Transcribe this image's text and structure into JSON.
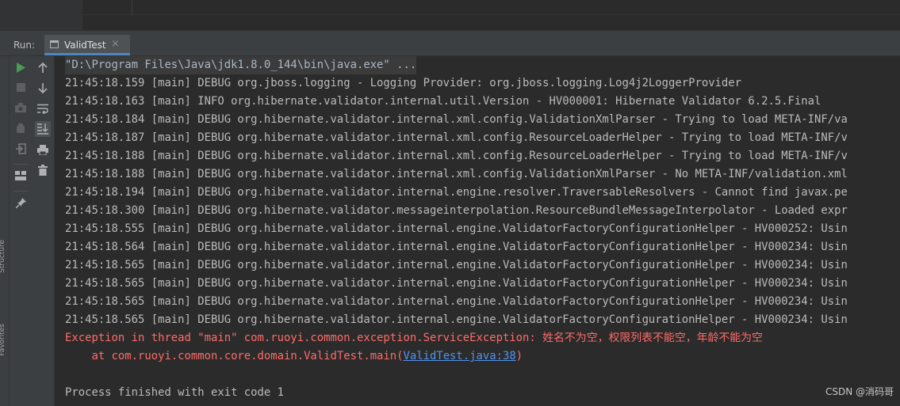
{
  "run_panel": {
    "label": "Run:",
    "tab_label": "ValidTest",
    "tab_close": "×"
  },
  "side_strip": {
    "items": [
      "Structure",
      "Favorites"
    ]
  },
  "toolbar": {
    "left_icons": [
      "run-icon",
      "stop-icon",
      "camera-icon",
      "debug-icon",
      "login-icon",
      "layout-icon",
      "pin-icon"
    ],
    "right_icons": [
      "up-arrow-icon",
      "down-arrow-icon",
      "soft-wrap-icon",
      "scroll-to-end-icon",
      "print-icon",
      "trash-icon"
    ]
  },
  "console": {
    "command_line": "\"D:\\Program Files\\Java\\jdk1.8.0_144\\bin\\java.exe\" ...",
    "log_lines": [
      "21:45:18.159 [main] DEBUG org.jboss.logging - Logging Provider: org.jboss.logging.Log4j2LoggerProvider",
      "21:45:18.163 [main] INFO org.hibernate.validator.internal.util.Version - HV000001: Hibernate Validator 6.2.5.Final",
      "21:45:18.184 [main] DEBUG org.hibernate.validator.internal.xml.config.ValidationXmlParser - Trying to load META-INF/va",
      "21:45:18.187 [main] DEBUG org.hibernate.validator.internal.xml.config.ResourceLoaderHelper - Trying to load META-INF/v",
      "21:45:18.188 [main] DEBUG org.hibernate.validator.internal.xml.config.ResourceLoaderHelper - Trying to load META-INF/v",
      "21:45:18.188 [main] DEBUG org.hibernate.validator.internal.xml.config.ValidationXmlParser - No META-INF/validation.xml",
      "21:45:18.194 [main] DEBUG org.hibernate.validator.internal.engine.resolver.TraversableResolvers - Cannot find javax.pe",
      "21:45:18.300 [main] DEBUG org.hibernate.validator.messageinterpolation.ResourceBundleMessageInterpolator - Loaded expr",
      "21:45:18.555 [main] DEBUG org.hibernate.validator.internal.engine.ValidatorFactoryConfigurationHelper - HV000252: Usin",
      "21:45:18.564 [main] DEBUG org.hibernate.validator.internal.engine.ValidatorFactoryConfigurationHelper - HV000234: Usin",
      "21:45:18.565 [main] DEBUG org.hibernate.validator.internal.engine.ValidatorFactoryConfigurationHelper - HV000234: Usin",
      "21:45:18.565 [main] DEBUG org.hibernate.validator.internal.engine.ValidatorFactoryConfigurationHelper - HV000234: Usin",
      "21:45:18.565 [main] DEBUG org.hibernate.validator.internal.engine.ValidatorFactoryConfigurationHelper - HV000234: Usin",
      "21:45:18.565 [main] DEBUG org.hibernate.validator.internal.engine.ValidatorFactoryConfigurationHelper - HV000234: Usin"
    ],
    "exception_line": "Exception in thread \"main\" com.ruoyi.common.exception.ServiceException: 姓名不为空，权限列表不能空，年龄不能为空",
    "stack_prefix": "    at com.ruoyi.common.core.domain.ValidTest.main(",
    "stack_link": "ValidTest.java:38",
    "stack_suffix": ")",
    "exit_line": "Process finished with exit code 1"
  },
  "watermark": "CSDN @消码哥",
  "colors": {
    "background": "#2b2b2b",
    "panel": "#3c3f41",
    "text": "#bbbbbb",
    "error": "#ff6b68",
    "link": "#5394ec",
    "run_green": "#499c54",
    "tab_accent": "#4a88c7"
  }
}
